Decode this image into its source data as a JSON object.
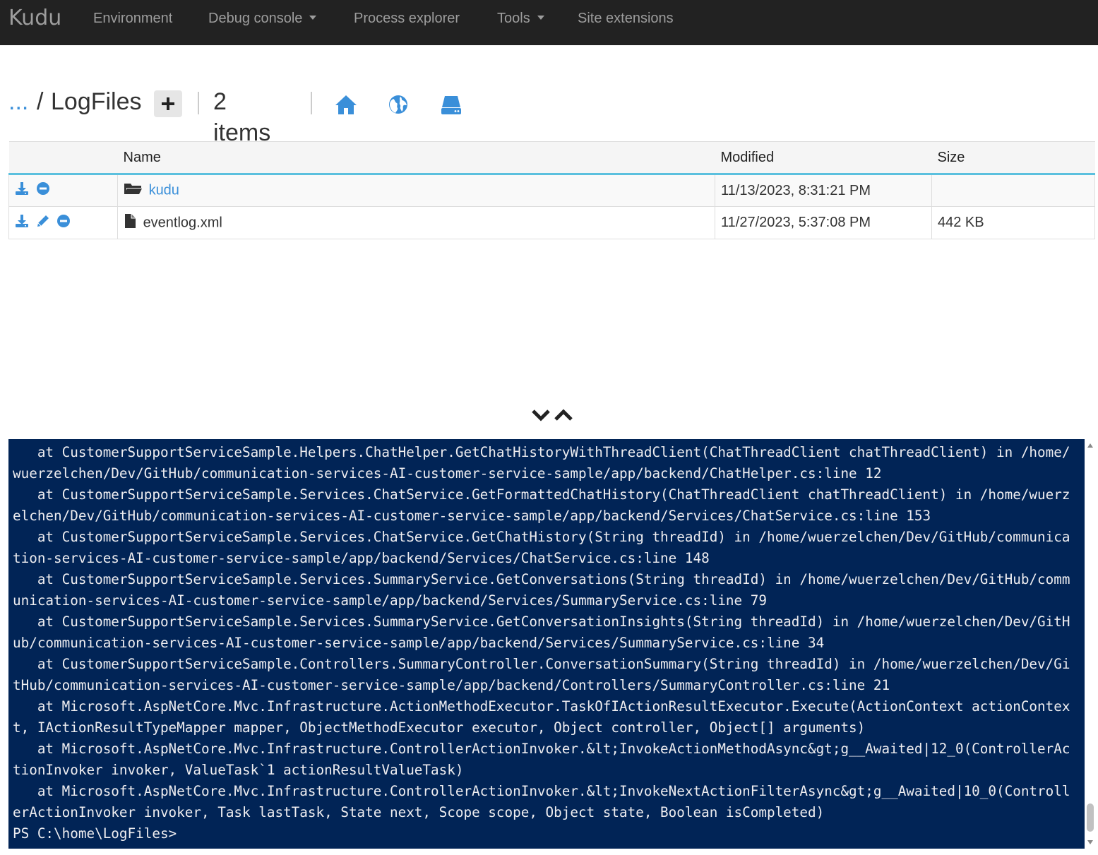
{
  "navbar": {
    "brand": "Kudu",
    "items": [
      {
        "label": "Environment",
        "has_dropdown": false
      },
      {
        "label": "Debug console",
        "has_dropdown": true
      },
      {
        "label": "Process explorer",
        "has_dropdown": false
      },
      {
        "label": "Tools",
        "has_dropdown": true
      },
      {
        "label": "Site extensions",
        "has_dropdown": false
      }
    ]
  },
  "breadcrumb": {
    "ellipsis": "...",
    "separator": "/",
    "current": "LogFiles",
    "item_count": "2 items",
    "icons": [
      "home-icon",
      "globe-icon",
      "drive-icon"
    ]
  },
  "table": {
    "headers": [
      "",
      "Name",
      "Modified",
      "Size"
    ],
    "rows": [
      {
        "actions": [
          "download-icon",
          "delete-icon"
        ],
        "type": "folder",
        "name": "kudu",
        "modified": "11/13/2023, 8:31:21 PM",
        "size": ""
      },
      {
        "actions": [
          "download-icon",
          "edit-icon",
          "delete-icon"
        ],
        "type": "file",
        "name": "eventlog.xml",
        "modified": "11/27/2023, 5:37:08 PM",
        "size": "442 KB"
      }
    ]
  },
  "console": {
    "lines": [
      "   at CustomerSupportServiceSample.Helpers.ChatHelper.GetChatHistoryWithThreadClient(ChatThreadClient chatThreadClient) in /home/wuerzelchen/Dev/GitHub/communication-services-AI-customer-service-sample/app/backend/ChatHelper.cs:line 12",
      "   at CustomerSupportServiceSample.Services.ChatService.GetFormattedChatHistory(ChatThreadClient chatThreadClient) in /home/wuerzelchen/Dev/GitHub/communication-services-AI-customer-service-sample/app/backend/Services/ChatService.cs:line 153",
      "   at CustomerSupportServiceSample.Services.ChatService.GetChatHistory(String threadId) in /home/wuerzelchen/Dev/GitHub/communication-services-AI-customer-service-sample/app/backend/Services/ChatService.cs:line 148",
      "   at CustomerSupportServiceSample.Services.SummaryService.GetConversations(String threadId) in /home/wuerzelchen/Dev/GitHub/communication-services-AI-customer-service-sample/app/backend/Services/SummaryService.cs:line 79",
      "   at CustomerSupportServiceSample.Services.SummaryService.GetConversationInsights(String threadId) in /home/wuerzelchen/Dev/GitHub/communication-services-AI-customer-service-sample/app/backend/Services/SummaryService.cs:line 34",
      "   at CustomerSupportServiceSample.Controllers.SummaryController.ConversationSummary(String threadId) in /home/wuerzelchen/Dev/GitHub/communication-services-AI-customer-service-sample/app/backend/Controllers/SummaryController.cs:line 21",
      "   at Microsoft.AspNetCore.Mvc.Infrastructure.ActionMethodExecutor.TaskOfIActionResultExecutor.Execute(ActionContext actionContext, IActionResultTypeMapper mapper, ObjectMethodExecutor executor, Object controller, Object[] arguments)",
      "   at Microsoft.AspNetCore.Mvc.Infrastructure.ControllerActionInvoker.&lt;InvokeActionMethodAsync&gt;g__Awaited|12_0(ControllerActionInvoker invoker, ValueTask`1 actionResultValueTask)",
      "   at Microsoft.AspNetCore.Mvc.Infrastructure.ControllerActionInvoker.&lt;InvokeNextActionFilterAsync&gt;g__Awaited|10_0(ControllerActionInvoker invoker, Task lastTask, State next, Scope scope, Object state, Boolean isCompleted)"
    ],
    "prompt": "PS C:\\home\\LogFiles>"
  },
  "colors": {
    "navbar_bg": "#222222",
    "accent": "#3a8fd9",
    "console_bg": "#012456",
    "header_underline": "#5bc0de"
  }
}
